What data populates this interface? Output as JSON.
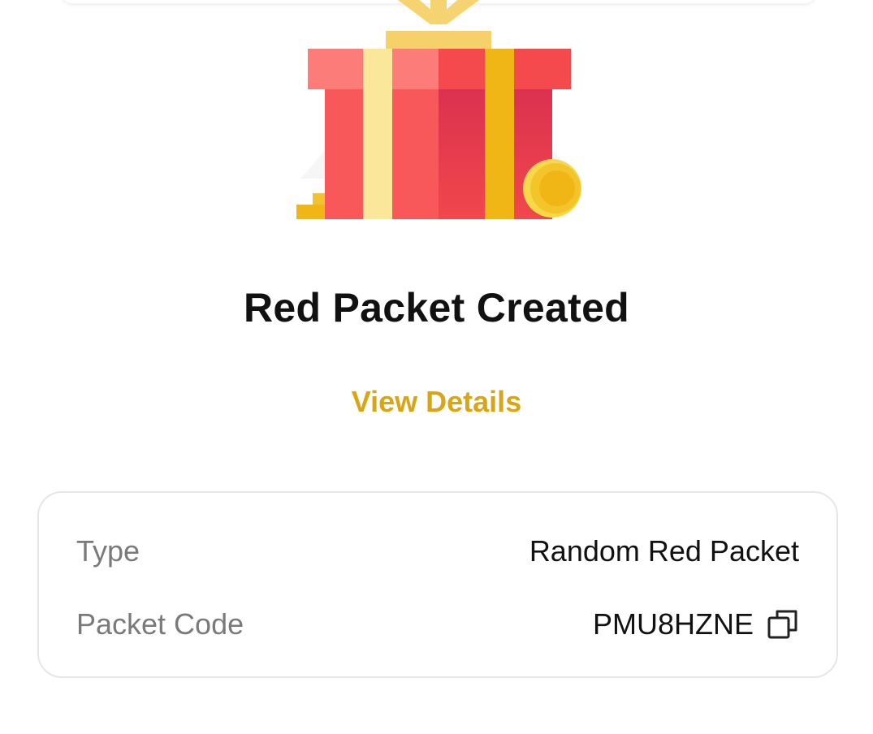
{
  "header": {
    "title": "Red Packet Created",
    "view_details_label": "View Details"
  },
  "details": {
    "type_label": "Type",
    "type_value": "Random Red Packet",
    "code_label": "Packet Code",
    "code_value": "PMU8HZNE"
  },
  "icons": {
    "hero": "gift-box-icon",
    "copy": "copy-icon"
  },
  "colors": {
    "accent": "#d9a514",
    "gift_red": "#f15052",
    "ribbon_yellow": "#f2b817"
  }
}
